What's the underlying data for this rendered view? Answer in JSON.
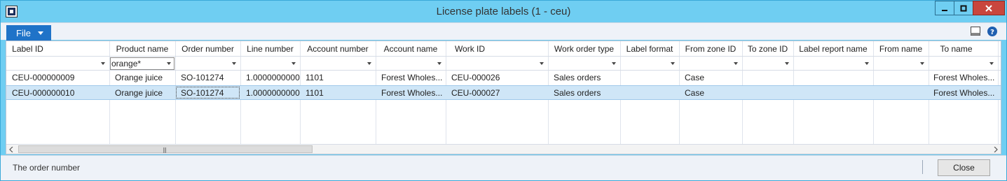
{
  "window": {
    "title": "License plate labels (1 - ceu)"
  },
  "menu": {
    "file_label": "File"
  },
  "grid": {
    "columns": [
      "Label ID",
      "Product name",
      "Order number",
      "Line number",
      "Account number",
      "Account name",
      "Work ID",
      "Work order type",
      "Label format",
      "From zone ID",
      "To zone ID",
      "Label report name",
      "From name",
      "To name"
    ],
    "filters": {
      "product_name": "orange*"
    },
    "rows": [
      [
        "CEU-000000009",
        "Orange juice",
        "SO-101274",
        "1.0000000000",
        "1101",
        "Forest Wholes...",
        "CEU-000026",
        "Sales orders",
        "",
        "Case",
        "",
        "",
        "",
        "Forest Wholes..."
      ],
      [
        "CEU-000000010",
        "Orange juice",
        "SO-101274",
        "1.0000000000",
        "1101",
        "Forest Wholes...",
        "CEU-000027",
        "Sales orders",
        "",
        "Case",
        "",
        "",
        "",
        "Forest Wholes..."
      ]
    ],
    "selected_row": 2
  },
  "status": {
    "text": "The order number",
    "close_label": "Close"
  },
  "colors": {
    "titlebar": "#6fcef2",
    "file_button": "#1f73c8",
    "selected_row": "#cfe6f7",
    "close_window": "#c9463d"
  }
}
